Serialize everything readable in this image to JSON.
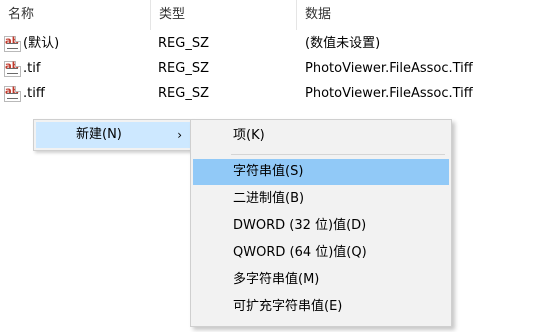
{
  "columns": {
    "name": "名称",
    "type": "类型",
    "data": "数据"
  },
  "rows": [
    {
      "name": "(默认)",
      "type": "REG_SZ",
      "data": "(数值未设置)",
      "icon": "ab-icon"
    },
    {
      "name": ".tif",
      "type": "REG_SZ",
      "data": "PhotoViewer.FileAssoc.Tiff",
      "icon": "ab-icon"
    },
    {
      "name": ".tiff",
      "type": "REG_SZ",
      "data": "PhotoViewer.FileAssoc.Tiff",
      "icon": "ab-icon"
    }
  ],
  "context_menu": {
    "new_label": "新建(N)",
    "arrow": "›"
  },
  "submenu": {
    "items": [
      {
        "label": "项(K)"
      },
      {
        "label": "字符串值(S)"
      },
      {
        "label": "二进制值(B)"
      },
      {
        "label": "DWORD (32 位)值(D)"
      },
      {
        "label": "QWORD (64 位)值(Q)"
      },
      {
        "label": "多字符串值(M)"
      },
      {
        "label": "可扩充字符串值(E)"
      }
    ],
    "selected_index": 1
  },
  "colors": {
    "hover": "#cde8ff",
    "selected": "#91c9f7",
    "menu_bg": "#f2f2f2",
    "icon_text": "#c0392b"
  }
}
